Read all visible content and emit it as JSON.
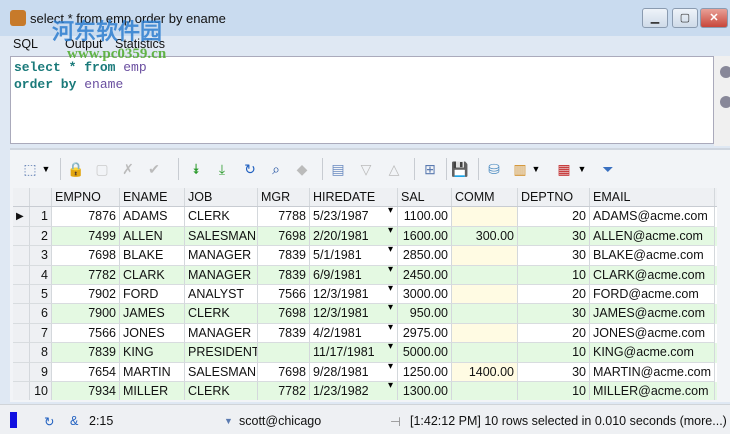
{
  "window": {
    "title": "select * from emp order by ename",
    "minimize": "▁",
    "maximize": "▢",
    "close": "✕"
  },
  "tabs": [
    {
      "label": "SQL"
    },
    {
      "label": "Output"
    },
    {
      "label": "Statistics"
    }
  ],
  "editor": {
    "line1": {
      "kw1": "select * from",
      "id": "emp"
    },
    "line2": {
      "kw": "order by",
      "id": "ename"
    }
  },
  "watermark": {
    "text": "河东软件园",
    "url": "www.pc0359.cn"
  },
  "grid": {
    "columns": [
      "",
      "EMPNO",
      "ENAME",
      "JOB",
      "MGR",
      "HIREDATE",
      "SAL",
      "COMM",
      "DEPTNO",
      "EMAIL"
    ],
    "rows": [
      [
        "1",
        "7876",
        "ADAMS",
        "CLERK",
        "7788",
        "5/23/1987",
        "1100.00",
        "",
        "20",
        "ADAMS@acme.com"
      ],
      [
        "2",
        "7499",
        "ALLEN",
        "SALESMAN",
        "7698",
        "2/20/1981",
        "1600.00",
        "300.00",
        "30",
        "ALLEN@acme.com"
      ],
      [
        "3",
        "7698",
        "BLAKE",
        "MANAGER",
        "7839",
        "5/1/1981",
        "2850.00",
        "",
        "30",
        "BLAKE@acme.com"
      ],
      [
        "4",
        "7782",
        "CLARK",
        "MANAGER",
        "7839",
        "6/9/1981",
        "2450.00",
        "",
        "10",
        "CLARK@acme.com"
      ],
      [
        "5",
        "7902",
        "FORD",
        "ANALYST",
        "7566",
        "12/3/1981",
        "3000.00",
        "",
        "20",
        "FORD@acme.com"
      ],
      [
        "6",
        "7900",
        "JAMES",
        "CLERK",
        "7698",
        "12/3/1981",
        "950.00",
        "",
        "30",
        "JAMES@acme.com"
      ],
      [
        "7",
        "7566",
        "JONES",
        "MANAGER",
        "7839",
        "4/2/1981",
        "2975.00",
        "",
        "20",
        "JONES@acme.com"
      ],
      [
        "8",
        "7839",
        "KING",
        "PRESIDENT",
        "",
        "11/17/1981",
        "5000.00",
        "",
        "10",
        "KING@acme.com"
      ],
      [
        "9",
        "7654",
        "MARTIN",
        "SALESMAN",
        "7698",
        "9/28/1981",
        "1250.00",
        "1400.00",
        "30",
        "MARTIN@acme.com"
      ],
      [
        "10",
        "7934",
        "MILLER",
        "CLERK",
        "7782",
        "1/23/1982",
        "1300.00",
        "",
        "10",
        "MILLER@acme.com"
      ]
    ]
  },
  "status": {
    "position": "2:15",
    "connection": "scott@chicago",
    "message": "[1:42:12 PM]  10 rows selected in 0.010 seconds (more...)"
  },
  "colors": {
    "even_row": "#e4f9e2",
    "comm_cell": "#fffbe3",
    "accent": "#1a7a7a"
  }
}
